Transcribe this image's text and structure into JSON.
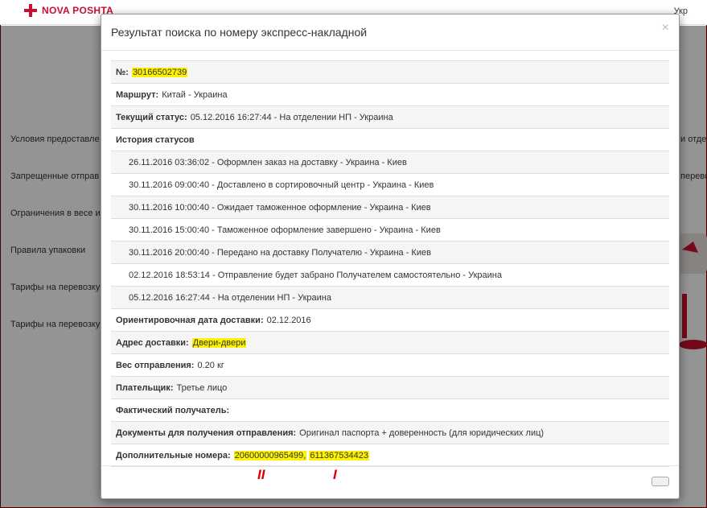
{
  "site": {
    "logo_text": "NOVA POSHTA",
    "lang": "Укр",
    "brand_color": "#c8102e",
    "side_items": [
      "Условия предоставле",
      "Запрещенные отправ",
      "Ограничения в весе и",
      "Правила упаковки",
      "Тарифы на перевозку",
      "Тарифы на перевозку"
    ],
    "right_fragments": [
      "и отдел",
      "перево"
    ]
  },
  "modal": {
    "title": "Результат поиска по номеру экспресс-накладной",
    "close_icon": "×",
    "rows": {
      "number_label": "№:",
      "number_value": "30166502739",
      "route_label": "Маршрут:",
      "route_value": "Китай - Украина",
      "status_label": "Текущий статус:",
      "status_value": "05.12.2016 16:27:44 - На отделении НП - Украина",
      "history_label": "История статусов",
      "history": [
        "26.11.2016 03:36:02 - Оформлен заказ на доставку - Украина - Киев",
        "30.11.2016 09:00:40 - Доставлено в сортировочный центр - Украина - Киев",
        "30.11.2016 10:00:40 - Ожидает таможенное оформление - Украина - Киев",
        "30.11.2016 15:00:40 - Таможенное оформление завершено - Украина - Киев",
        "30.11.2016 20:00:40 - Передано на доставку Получателю - Украина - Киев",
        "02.12.2016 18:53:14 - Отправление будет забрано Получателем самостоятельно - Украина",
        "05.12.2016 16:27:44 - На отделении НП - Украина"
      ],
      "eta_label": "Ориентировочная дата доставки:",
      "eta_value": "02.12.2016",
      "address_label": "Адрес доставки:",
      "address_value": "Двери-двери",
      "weight_label": "Вес отправления:",
      "weight_value": "0.20 кг",
      "payer_label": "Плательщик:",
      "payer_value": "Третье лицо",
      "recipient_label": "Фактический получатель:",
      "docs_label": "Документы для получения отправления:",
      "docs_value": "Оригинал паспорта + доверенность (для юридических лиц)",
      "extra_label": "Дополнительные номера:",
      "extra_value_1": "20600000965499,",
      "extra_value_2": "611367534423"
    }
  },
  "annotations": {
    "mark_2": "II",
    "mark_1": "I"
  },
  "highlight_color": "#fff200",
  "annotation_color": "#e00000"
}
